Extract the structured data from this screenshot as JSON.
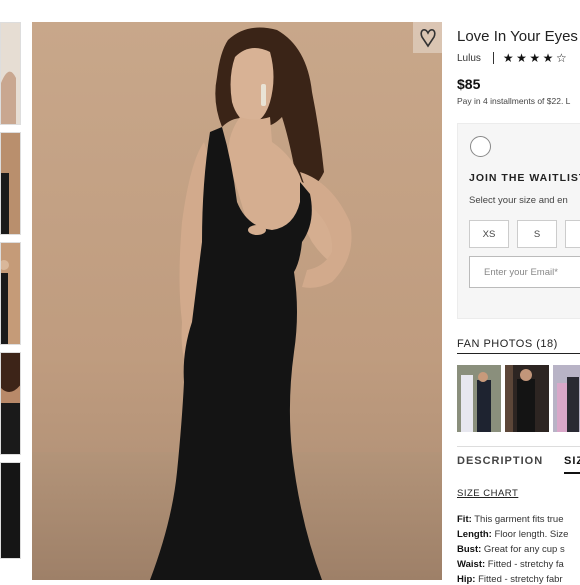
{
  "product": {
    "title": "Love In Your Eyes",
    "brand": "Lulus",
    "rating_stars": "★★★★☆",
    "price": "$85",
    "installments": "Pay in 4 installments of $22. L"
  },
  "waitlist": {
    "title": "JOIN THE WAITLIST",
    "subtitle": "Select your size and en",
    "sizes": [
      "XS",
      "S",
      ""
    ],
    "email_placeholder": "Enter your Email*"
  },
  "fan_photos": {
    "title": "FAN PHOTOS (18)"
  },
  "tabs": {
    "description": "DESCRIPTION",
    "size": "SIZ"
  },
  "size_chart_label": "SIZE CHART",
  "specs": [
    {
      "label": "Fit:",
      "text": "This garment fits true"
    },
    {
      "label": "Length:",
      "text": "Floor length. Size"
    },
    {
      "label": "Bust:",
      "text": "Great for any cup s"
    },
    {
      "label": "Waist:",
      "text": "Fitted - stretchy fa"
    },
    {
      "label": "Hip:",
      "text": "Fitted - stretchy fabr"
    }
  ],
  "icons": {
    "favorite": "heart-icon",
    "radio": "radio-button"
  },
  "colors": {
    "background_photo": "#c0a287",
    "dress": "#141414",
    "text": "#222222",
    "panel_box": "#f6f6f6"
  }
}
